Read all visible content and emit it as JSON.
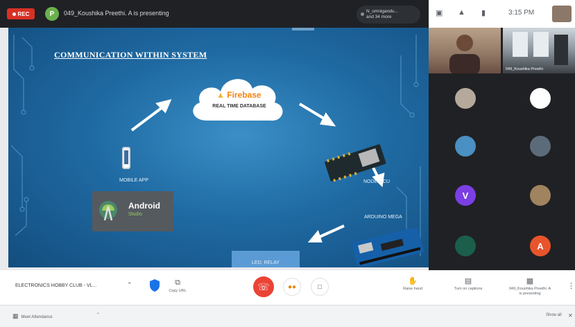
{
  "top_bar": {
    "rec_label": "REC",
    "presenter_initial": "P",
    "presenting_text": "049_Koushika Preethi. A is presenting",
    "others_line1": "N_omnigandu...",
    "others_line2": "and 34 more"
  },
  "status_bar": {
    "time": "3:15 PM"
  },
  "slide": {
    "title": "COMMUNICATION WITHIN SYSTEM",
    "firebase_label": "Firebase",
    "database_label": "REAL TIME DATABASE",
    "mobile_app_label": "MOBILE APP",
    "android_label": "Android",
    "android_sub": "Studio",
    "nodemcu_label": "NODE MCU",
    "arduino_label": "ARDUINO MEGA",
    "relay_label": "LED, RELAY"
  },
  "participants": {
    "video2_name": "049_Koushika Preethi",
    "tiles": [
      {
        "initial": "",
        "color": "#b5a99b"
      },
      {
        "initial": "",
        "color": "#ffffff"
      },
      {
        "initial": "",
        "color": "#4a90c2"
      },
      {
        "initial": "",
        "color": "#5c6b7a"
      },
      {
        "initial": "V",
        "color": "#7b3fe4"
      },
      {
        "initial": "",
        "color": "#a0835f"
      },
      {
        "initial": "",
        "color": "#1b5e4a"
      },
      {
        "initial": "A",
        "color": "#e8542c"
      }
    ]
  },
  "controls": {
    "meeting_name": "ELECTRONICS HOBBY CLUB - VL...",
    "copy_url_label": "Copy URL",
    "raise_hand_label": "Raise hand",
    "captions_label": "Turn on captions",
    "presenting_label_1": "049_Koushika Preethi. A",
    "presenting_label_2": "is presenting"
  },
  "ext_bar": {
    "chip_label": "Meet Attendance",
    "show_all": "Show all"
  }
}
